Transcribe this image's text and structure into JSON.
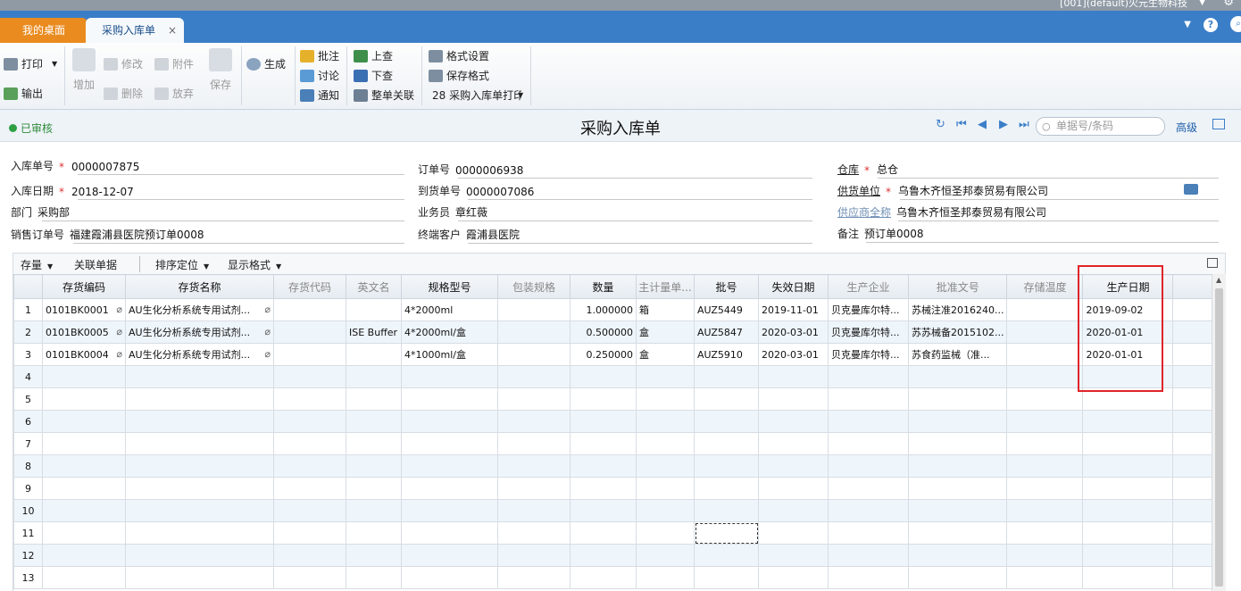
{
  "top_strip": {
    "account_text": "[001](default)火元生物科技",
    "menu_icon": "chevron-down-icon",
    "settings_icon": "gear-icon"
  },
  "tabs": [
    {
      "label": "我的桌面",
      "active": false
    },
    {
      "label": "采购入库单",
      "active": true,
      "close": "×"
    }
  ],
  "tabbar_icons": {
    "dropdown": "chevron-down-icon",
    "help": "?",
    "search": "search-icon"
  },
  "toolbar": {
    "print": "打印",
    "export": "输出",
    "add": "增加",
    "edit": "修改",
    "attach": "附件",
    "delete": "删除",
    "discard": "放弃",
    "save": "保存",
    "generate": "生成",
    "annotate": "批注",
    "discuss": "讨论",
    "notify": "通知",
    "prev_query": "上查",
    "next_query": "下查",
    "doc_link": "整单关联",
    "format_settings": "格式设置",
    "save_format": "保存格式",
    "print_template": "28 采购入库单打印"
  },
  "status": {
    "label": "已审核",
    "color": "#2ea043"
  },
  "page_title": "采购入库单",
  "search": {
    "placeholder": "单据号/条码"
  },
  "advanced_label": "高级",
  "form": {
    "receipt_no_label": "入库单号",
    "receipt_no": "0000007875",
    "receipt_date_label": "入库日期",
    "receipt_date": "2018-12-07",
    "dept_label": "部门",
    "dept": "采购部",
    "sales_order_label": "销售订单号",
    "sales_order": "福建霞浦县医院预订单0008",
    "order_no_label": "订单号",
    "order_no": "0000006938",
    "arrival_no_label": "到货单号",
    "arrival_no": "0000007086",
    "clerk_label": "业务员",
    "clerk": "章红薇",
    "end_customer_label": "终端客户",
    "end_customer": "霞浦县医院",
    "warehouse_label": "仓库",
    "warehouse": "总仓",
    "supplier_label": "供货单位",
    "supplier": "乌鲁木齐恒圣邦泰贸易有限公司",
    "supplier_full_label": "供应商全称",
    "supplier_full": "乌鲁木齐恒圣邦泰贸易有限公司",
    "remark_label": "备注",
    "remark": "预订单0008",
    "required_mark": "*"
  },
  "grid_toolbar": {
    "stock": "存量",
    "related_docs": "关联单据",
    "sort_locate": "排序定位",
    "display_format": "显示格式"
  },
  "columns": [
    "",
    "存货编码",
    "存货名称",
    "存货代码",
    "英文名",
    "规格型号",
    "包装规格",
    "数量",
    "主计量单...",
    "批号",
    "失效日期",
    "生产企业",
    "批准文号",
    "存储温度",
    "生产日期",
    ""
  ],
  "rows": [
    [
      "1",
      "0101BK0001",
      "AU生化分析系统专用试剂...",
      "",
      "",
      "4*2000ml",
      "",
      "1.000000",
      "箱",
      "AUZ5449",
      "2019-11-01",
      "贝克曼库尔特...",
      "苏械注准2016240...",
      "",
      "2019-09-02",
      ""
    ],
    [
      "2",
      "0101BK0005",
      "AU生化分析系统专用试剂...",
      "",
      "ISE Buffer",
      "4*2000ml/盒",
      "",
      "0.500000",
      "盒",
      "AUZ5847",
      "2020-03-01",
      "贝克曼库尔特...",
      "苏苏械备2015102...",
      "",
      "2020-01-01",
      ""
    ],
    [
      "3",
      "0101BK0004",
      "AU生化分析系统专用试剂...",
      "",
      "",
      "4*1000ml/盒",
      "",
      "0.250000",
      "盒",
      "AUZ5910",
      "2020-03-01",
      "贝克曼库尔特...",
      "苏食药监械（准...",
      "",
      "2020-01-01",
      ""
    ],
    [
      "4",
      "",
      "",
      "",
      "",
      "",
      "",
      "",
      "",
      "",
      "",
      "",
      "",
      "",
      "",
      ""
    ],
    [
      "5",
      "",
      "",
      "",
      "",
      "",
      "",
      "",
      "",
      "",
      "",
      "",
      "",
      "",
      "",
      ""
    ],
    [
      "6",
      "",
      "",
      "",
      "",
      "",
      "",
      "",
      "",
      "",
      "",
      "",
      "",
      "",
      "",
      ""
    ],
    [
      "7",
      "",
      "",
      "",
      "",
      "",
      "",
      "",
      "",
      "",
      "",
      "",
      "",
      "",
      "",
      ""
    ],
    [
      "8",
      "",
      "",
      "",
      "",
      "",
      "",
      "",
      "",
      "",
      "",
      "",
      "",
      "",
      "",
      ""
    ],
    [
      "9",
      "",
      "",
      "",
      "",
      "",
      "",
      "",
      "",
      "",
      "",
      "",
      "",
      "",
      "",
      ""
    ],
    [
      "10",
      "",
      "",
      "",
      "",
      "",
      "",
      "",
      "",
      "",
      "",
      "",
      "",
      "",
      "",
      ""
    ],
    [
      "11",
      "",
      "",
      "",
      "",
      "",
      "",
      "",
      "",
      "",
      "",
      "",
      "",
      "",
      "",
      ""
    ],
    [
      "12",
      "",
      "",
      "",
      "",
      "",
      "",
      "",
      "",
      "",
      "",
      "",
      "",
      "",
      "",
      ""
    ],
    [
      "13",
      "",
      "",
      "",
      "",
      "",
      "",
      "",
      "",
      "",
      "",
      "",
      "",
      "",
      "",
      ""
    ]
  ],
  "highlight_color": "#e0242b"
}
